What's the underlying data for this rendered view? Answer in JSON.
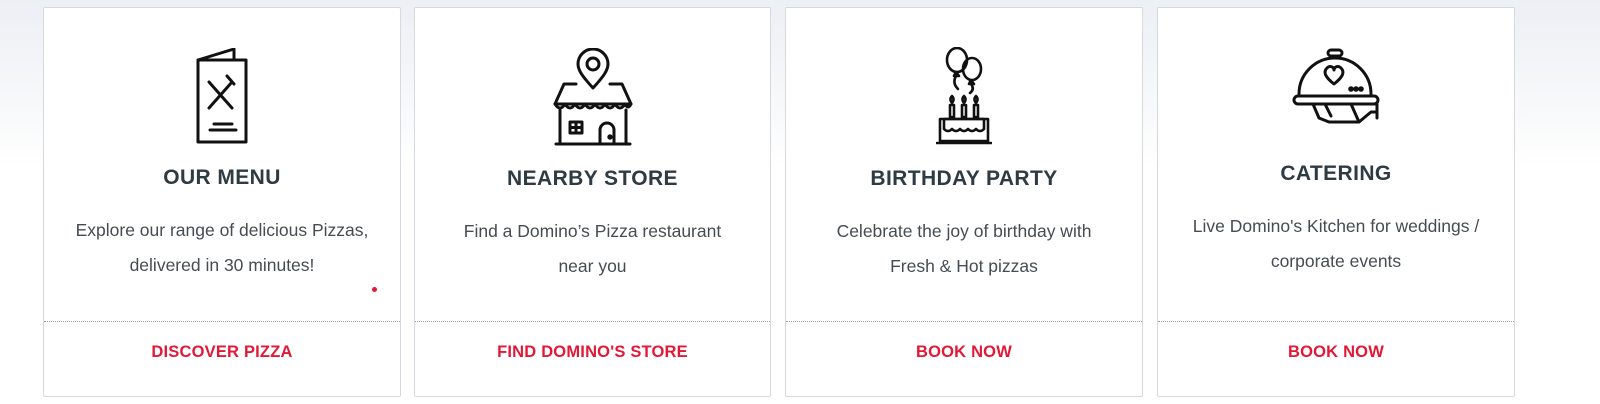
{
  "cards": [
    {
      "icon": "menu-card-icon",
      "title": "OUR MENU",
      "description": "Explore our range of delicious Pizzas, delivered in 30 minutes!",
      "cta": "DISCOVER PIZZA"
    },
    {
      "icon": "store-location-icon",
      "title": "NEARBY STORE",
      "description": "Find a Domino’s Pizza restaurant near you",
      "cta": "FIND DOMINO'S STORE"
    },
    {
      "icon": "birthday-cake-icon",
      "title": "BIRTHDAY PARTY",
      "description": "Celebrate the joy of birthday with Fresh & Hot pizzas",
      "cta": "BOOK NOW"
    },
    {
      "icon": "catering-cloche-icon",
      "title": "CATERING",
      "description": "Live Domino's Kitchen for weddings / corporate events",
      "cta": "BOOK NOW"
    }
  ],
  "colors": {
    "heading": "#2e3b42",
    "body_text": "#464c52",
    "cta": "#e31837",
    "border": "#d6d9de"
  }
}
